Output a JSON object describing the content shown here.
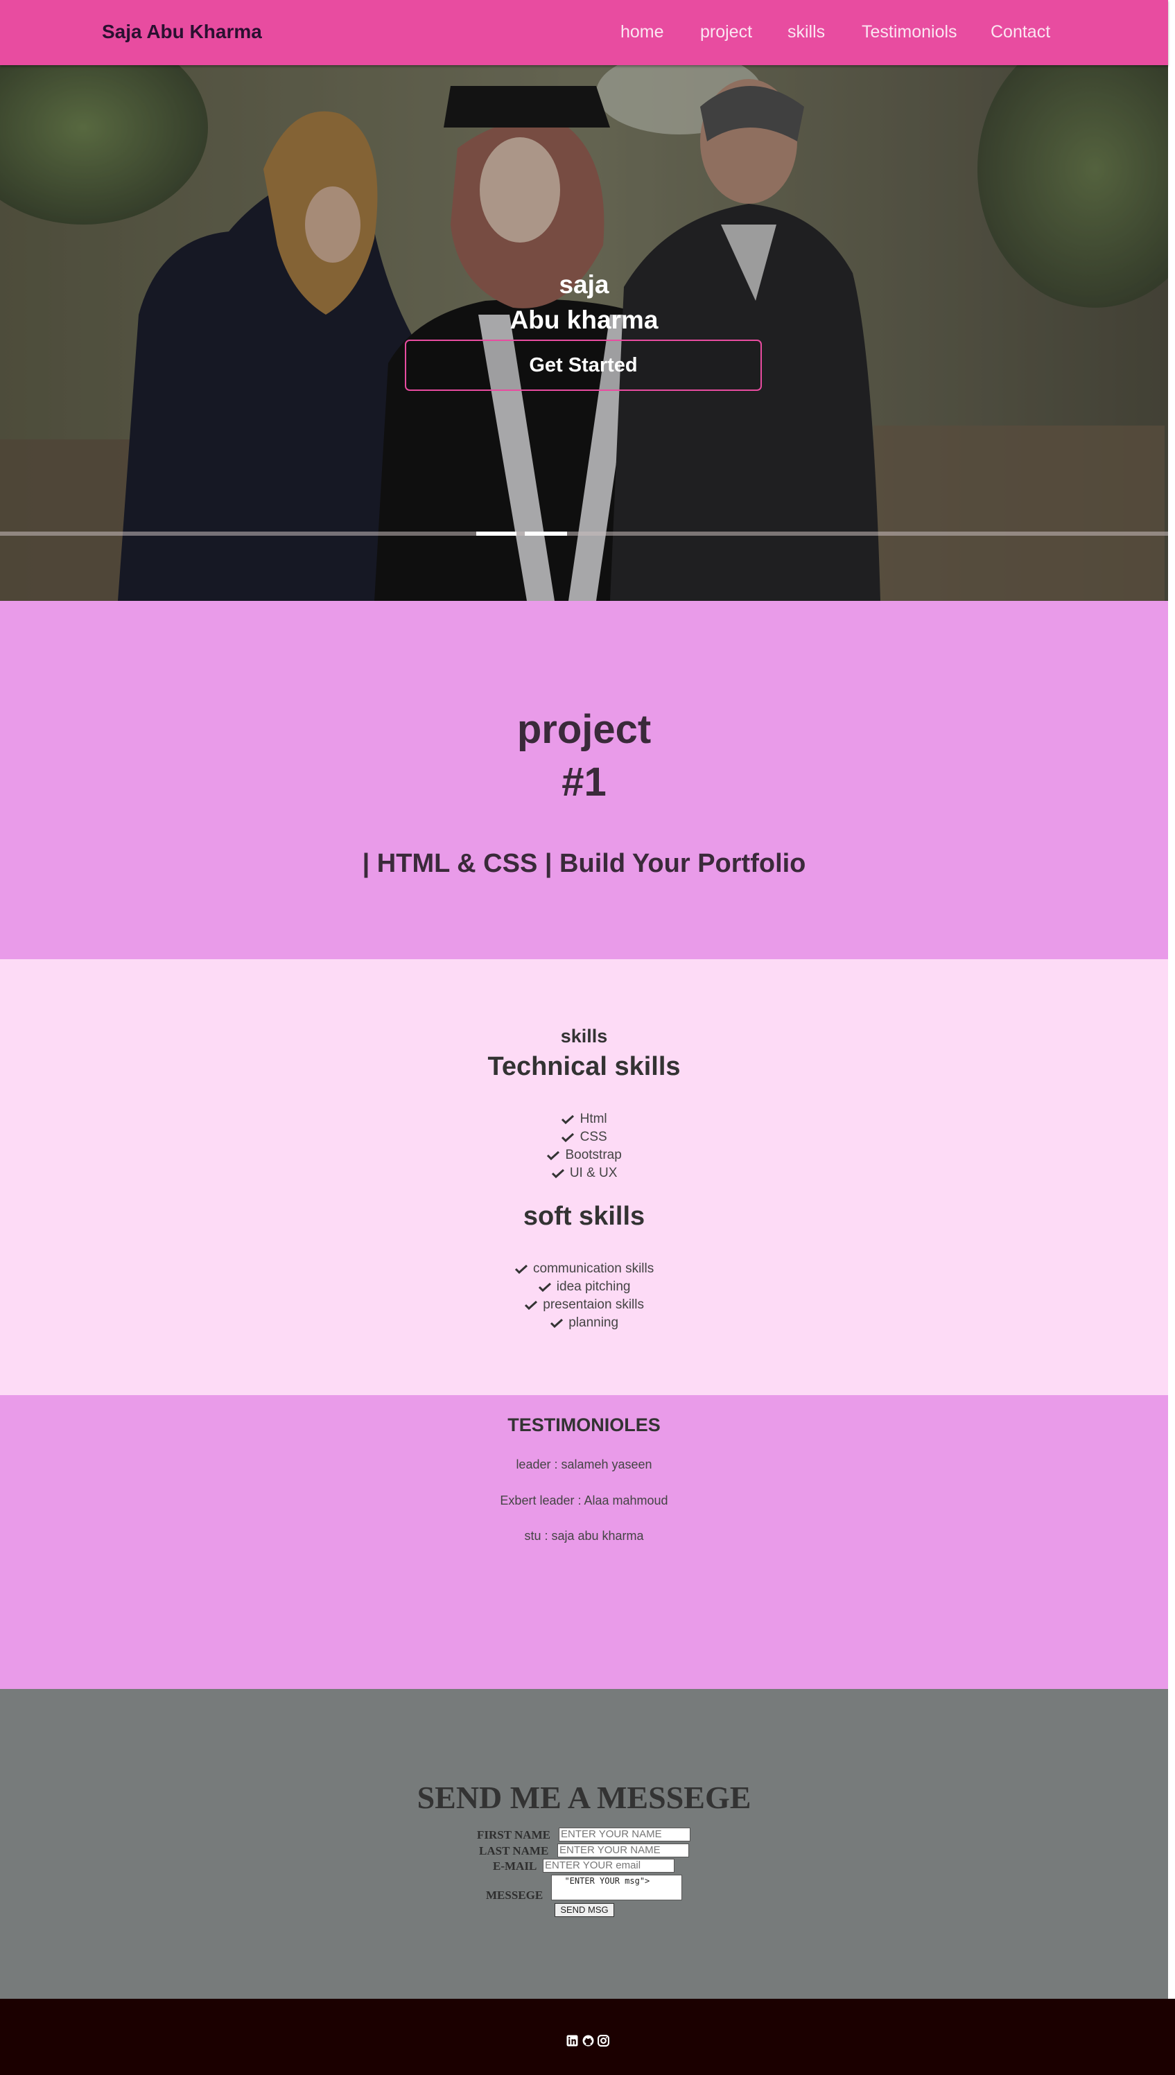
{
  "navbar": {
    "brand": "Saja Abu Kharma",
    "links": [
      "home",
      "project",
      "skills",
      "Testimoniols",
      "Contact"
    ]
  },
  "hero": {
    "name_line1": "saja",
    "name_line2": "Abu kharma",
    "cta_label": "Get Started"
  },
  "project": {
    "title_line1": "project",
    "title_line2": "#1",
    "subtitle": "| HTML & CSS | Build Your Portfolio"
  },
  "skills": {
    "section_label": "skills",
    "technical_title": "Technical skills",
    "technical_items": [
      "Html",
      "CSS",
      "Bootstrap",
      "UI & UX"
    ],
    "soft_title": "soft skills",
    "soft_items": [
      "communication skills",
      "idea pitching",
      "presentaion skills",
      "planning"
    ]
  },
  "testimonials": {
    "title": "TESTIMONIOLES",
    "items": [
      "leader : salameh yaseen",
      "Exbert leader : Alaa mahmoud",
      "stu : saja abu kharma"
    ]
  },
  "contact": {
    "title": "SEND ME A MESSEGE",
    "first_name_label": "FIRST NAME",
    "first_name_placeholder": "ENTER YOUR NAME",
    "last_name_label": "LAST NAME",
    "last_name_placeholder": "ENTER YOUR NAME",
    "email_label": "E-MAIL",
    "email_placeholder": "ENTER YOUR email",
    "message_label": "MESSEGE",
    "message_value": "  \"ENTER YOUR msg\">",
    "send_label": "SEND MSG"
  },
  "footer": {
    "icons": [
      "linkedin-icon",
      "github-icon",
      "instagram-icon"
    ]
  },
  "colors": {
    "navbar": "#e84ca0",
    "project_bg": "#e99be9",
    "skills_bg": "#fddbf6",
    "contact_bg": "#777b7b",
    "footer_bg": "#1b0000"
  }
}
